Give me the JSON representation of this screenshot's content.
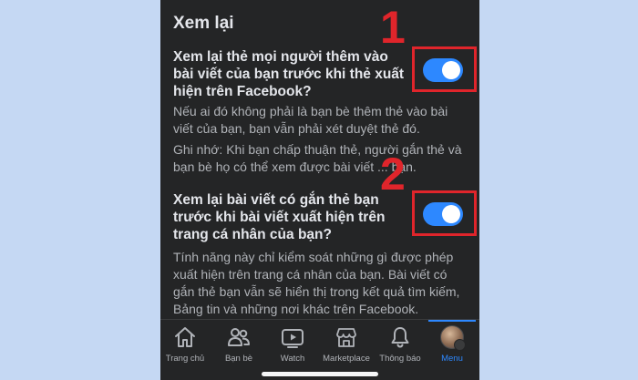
{
  "section": {
    "title": "Xem lại"
  },
  "settings": [
    {
      "title": "Xem lại thẻ mọi người thêm vào bài viết của bạn trước khi thẻ xuất hiện trên Facebook?",
      "enabled": true,
      "descriptions": [
        "Nếu ai đó không phải là bạn bè thêm thẻ vào bài viết của bạn, bạn vẫn phải xét duyệt thẻ đó.",
        "Ghi nhớ: Khi bạn chấp thuận thẻ, người gắn thẻ và bạn bè họ có thể xem được bài viết ... bạn."
      ]
    },
    {
      "title": "Xem lại bài viết có gắn thẻ bạn trước khi bài viết xuất hiện trên trang cá nhân của bạn?",
      "enabled": true,
      "descriptions": [
        "Tính năng này chỉ kiểm soát những gì được phép xuất hiện trên trang cá nhân của bạn. Bài viết có gắn thẻ bạn vẫn sẽ hiển thị trong kết quả tìm kiếm, Bảng tin và những nơi khác trên Facebook."
      ]
    }
  ],
  "annotations": {
    "marker1": "1",
    "marker2": "2",
    "color": "#e0252b"
  },
  "colors": {
    "accent": "#2d88ff",
    "background": "#242526",
    "page_background": "#c5d8f3"
  },
  "tabbar": {
    "tabs": [
      {
        "label": "Trang chủ",
        "icon": "home-icon"
      },
      {
        "label": "Bạn bè",
        "icon": "friends-icon"
      },
      {
        "label": "Watch",
        "icon": "watch-icon"
      },
      {
        "label": "Marketplace",
        "icon": "marketplace-icon"
      },
      {
        "label": "Thông báo",
        "icon": "bell-icon"
      },
      {
        "label": "Menu",
        "icon": "avatar",
        "active": true
      }
    ]
  }
}
